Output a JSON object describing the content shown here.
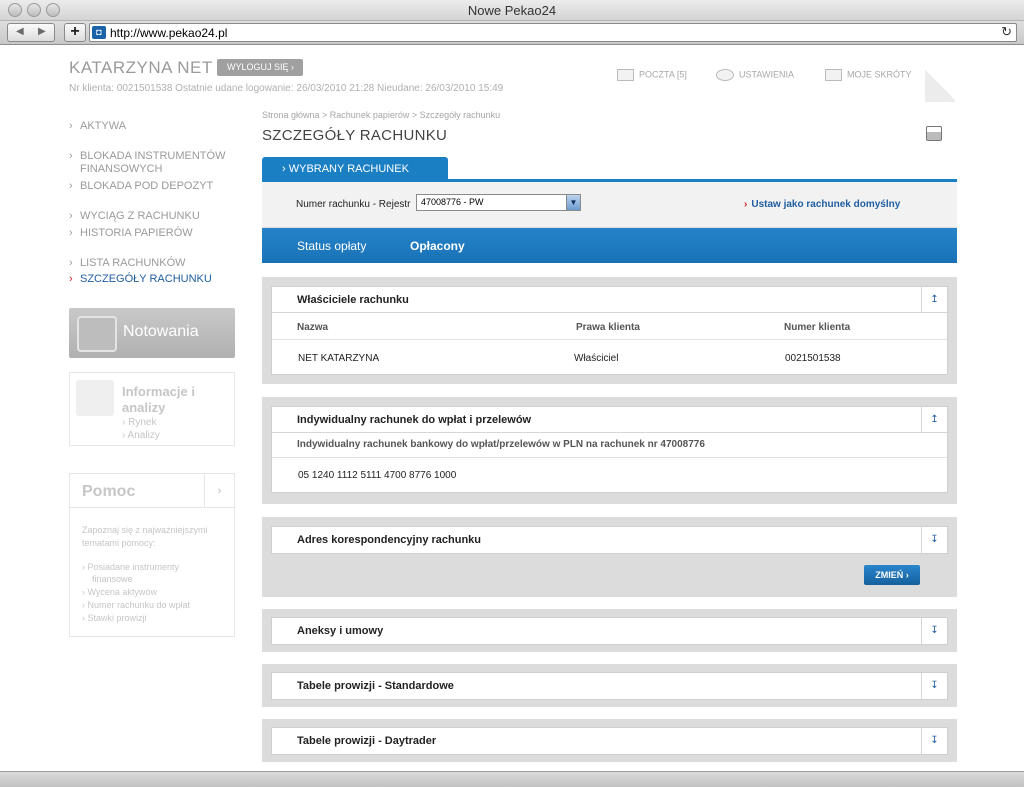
{
  "window": {
    "title": "Nowe Pekao24"
  },
  "browser": {
    "url": "http://www.pekao24.pl",
    "back": "◀",
    "forward": "▶",
    "add": "+",
    "reload": "↻"
  },
  "header": {
    "user_name": "KATARZYNA NET",
    "logout_label": "WYLOGUJ SIĘ  ›",
    "client_info": "Nr klienta: 0021501538  Ostatnie udane logowanie: 26/03/2010 21:28  Nieudane: 26/03/2010 15:49",
    "links": [
      {
        "label": "POCZTA [5]",
        "icon": "mail-icon"
      },
      {
        "label": "USTAWIENIA",
        "icon": "gears-icon"
      },
      {
        "label": "MOJE SKRÓTY",
        "icon": "shortcut-icon"
      }
    ]
  },
  "sidebar": {
    "items": [
      {
        "label": "AKTYWA"
      },
      {
        "label": "BLOKADA INSTRUMENTÓW"
      },
      {
        "label": "FINANSOWYCH"
      },
      {
        "label": "BLOKADA POD DEPOZYT"
      },
      {
        "label": "WYCIĄG Z RACHUNKU"
      },
      {
        "label": "HISTORIA PAPIERÓW"
      },
      {
        "label": "LISTA RACHUNKÓW"
      },
      {
        "label": "SZCZEGÓŁY RACHUNKU"
      }
    ],
    "arrow": "›",
    "notowania": "Notowania",
    "info": {
      "title_line1": "Informacje i",
      "title_line2": "analizy",
      "links": [
        "› Rynek",
        "› Analizy"
      ]
    },
    "help": {
      "title": "Pomoc",
      "arrow": "›",
      "intro": "Zapoznaj się z najważniejszymi tematami pomocy:",
      "links": [
        "› Posiadane instrumenty",
        "finansowe",
        "› Wycena aktywów",
        "› Numer rachunku do wpłat",
        "› Stawki prowizji"
      ]
    }
  },
  "main": {
    "breadcrumb": "Strona główna > Rachunek papierów > Szczegóły rachunku",
    "title": "SZCZEGÓŁY RACHUNKU",
    "account_tab": "›   WYBRANY RACHUNEK",
    "account_label": "Numer rachunku - Rejestr",
    "account_value": "47008776 - PW",
    "select_arrow": "▼",
    "default_arrow": "›",
    "default_link": "Ustaw jako rachunek domyślny",
    "status_label": "Status opłaty",
    "status_value": "Opłacony",
    "sections": {
      "owners": {
        "title": "Właściciele rachunku",
        "toggle": "↥",
        "columns": [
          "Nazwa",
          "Prawa klienta",
          "Numer klienta"
        ],
        "row": [
          "NET KATARZYNA",
          "Właściciel",
          "0021501538"
        ]
      },
      "individual": {
        "title": "Indywidualny rachunek do wpłat i przelewów",
        "toggle": "↥",
        "subtitle": "Indywidualny rachunek bankowy do wpłat/przelewów w PLN na rachunek nr 47008776",
        "account_number": "05 1240 1112 5111 4700 8776 1000"
      },
      "address": {
        "title": "Adres korespondencyjny rachunku",
        "toggle": "↧",
        "change_button": "ZMIEŃ  ›"
      },
      "annex": {
        "title": "Aneksy i umowy",
        "toggle": "↧"
      },
      "fees_standard": {
        "title": "Tabele prowizji  -  Standardowe",
        "toggle": "↧"
      },
      "fees_daytrader": {
        "title": "Tabele prowizji  -  Daytrader",
        "toggle": "↧"
      }
    }
  },
  "colors": {
    "accent": "#1b7fc4",
    "link": "#1f5ea1",
    "red_arrow": "#cf1f22"
  }
}
